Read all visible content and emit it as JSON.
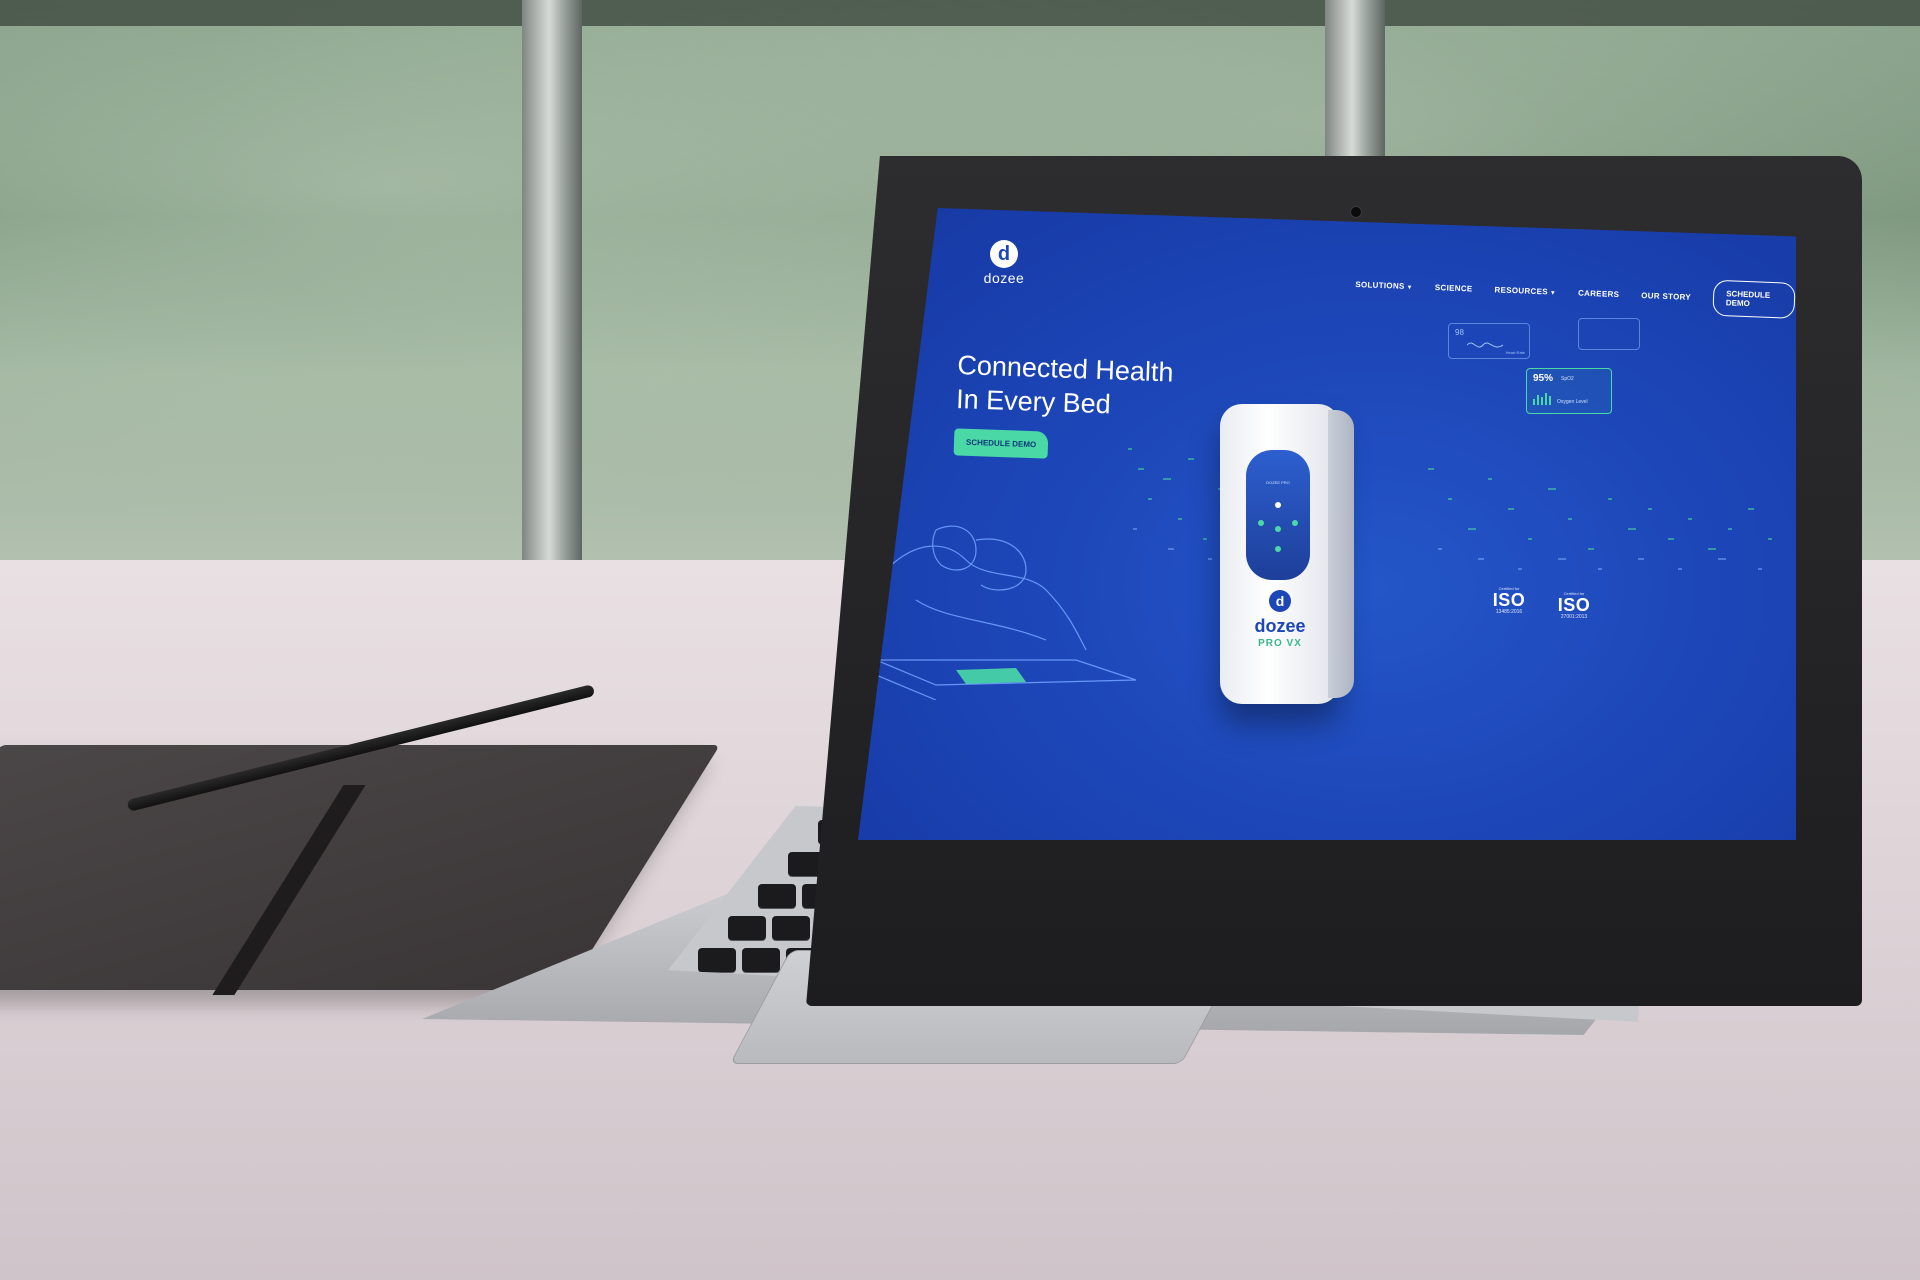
{
  "site": {
    "logo_text": "dozee",
    "logo_letter": "d",
    "nav": [
      {
        "label": "SOLUTIONS",
        "has_dropdown": true
      },
      {
        "label": "SCIENCE",
        "has_dropdown": false
      },
      {
        "label": "RESOURCES",
        "has_dropdown": true
      },
      {
        "label": "CAREERS",
        "has_dropdown": false
      },
      {
        "label": "OUR STORY",
        "has_dropdown": false
      }
    ],
    "nav_cta": "SCHEDULE DEMO",
    "hero": {
      "title_line1": "Connected Health",
      "title_line2": "In Every Bed",
      "cta": "SCHEDULE DEMO"
    },
    "device": {
      "brand": "dozee",
      "model": "PRO VX",
      "panel_label": "DOZEE PRO"
    },
    "vitals": {
      "heart_value": "98",
      "heart_label": "Heart Rate",
      "spo2_value": "95%",
      "spo2_unit": "SpO2",
      "spo2_label": "Oxygen Level"
    },
    "certifications": [
      {
        "prefix": "Certified for",
        "name": "ISO",
        "code": "13485:2016"
      },
      {
        "prefix": "Certified for",
        "name": "ISO",
        "code": "27001:2013"
      }
    ]
  },
  "colors": {
    "screen_blue": "#1d47b9",
    "accent_green": "#4ad9a6",
    "text_white": "#ffffff"
  }
}
